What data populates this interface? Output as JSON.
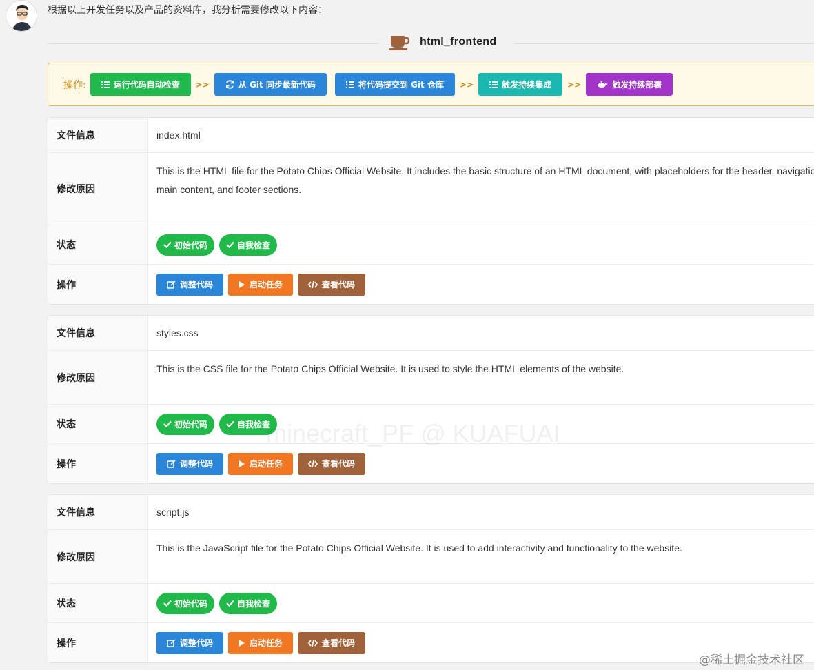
{
  "intro_text": "根据以上开发任务以及产品的资料库，我分析需要修改以下内容：",
  "section_title": "html_frontend",
  "ops_bar": {
    "label": "操作:",
    "separator": ">>",
    "buttons": [
      {
        "label": "运行代码自动检查",
        "color": "#1fb94e",
        "icon": "list-check-icon"
      },
      {
        "label": "从 Git 同步最新代码",
        "color": "#2a86d8",
        "icon": "sync-icon"
      },
      {
        "label": "将代码提交到 Git 仓库",
        "color": "#2a86d8",
        "icon": "list-check-icon"
      },
      {
        "label": "触发持续集成",
        "color": "#1bb8b0",
        "icon": "list-check-icon"
      },
      {
        "label": "触发持续部署",
        "color": "#a334c9",
        "icon": "docker-icon"
      }
    ]
  },
  "labels": {
    "file_info": "文件信息",
    "reason": "修改原因",
    "status": "状态",
    "actions": "操作"
  },
  "status_pills": [
    "初始代码",
    "自我检查"
  ],
  "action_buttons": [
    {
      "label": "调整代码",
      "color": "#2a86d8",
      "icon": "edit-icon"
    },
    {
      "label": "启动任务",
      "color": "#f17722",
      "icon": "play-icon"
    },
    {
      "label": "查看代码",
      "color": "#a0623b",
      "icon": "code-icon"
    }
  ],
  "files": [
    {
      "name": "index.html",
      "reason": "This is the HTML file for the Potato Chips Official Website. It includes the basic structure of an HTML document, with placeholders for the header, navigation, main content, and footer sections."
    },
    {
      "name": "styles.css",
      "reason": "This is the CSS file for the Potato Chips Official Website. It is used to style the HTML elements of the website."
    },
    {
      "name": "script.js",
      "reason": "This is the JavaScript file for the Potato Chips Official Website. It is used to add interactivity and functionality to the website."
    }
  ],
  "watermark": "minecraft_PF @ KUAFUAI",
  "footer_watermark": "@稀土掘金技术社区"
}
